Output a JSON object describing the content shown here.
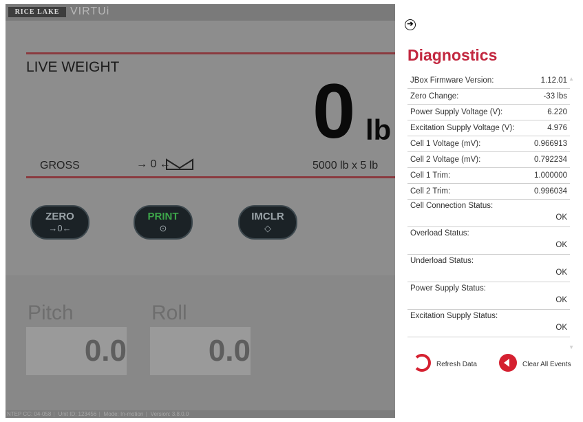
{
  "app": {
    "logo_text": "RICE LAKE",
    "brand": "VIRTUi",
    "live_weight_label": "LIVE WEIGHT",
    "weight_value": "0",
    "weight_unit": "lb",
    "gross_label": "GROSS",
    "zero_symbol": "→ 0 ←",
    "capacity": "5000 lb x 5 lb",
    "buttons": [
      {
        "label": "ZERO",
        "symbol": "→0←"
      },
      {
        "label": "PRINT",
        "symbol": "⊙"
      },
      {
        "label": "IMCLR",
        "symbol": "◇"
      }
    ],
    "pitch_label": "Pitch",
    "pitch_value": "0.0",
    "roll_label": "Roll",
    "roll_value": "0.0",
    "status": {
      "ntep": "NTEP CC: 04-058",
      "unit_id": "Unit ID: 123456",
      "mode": "Mode: In-motion",
      "version": "Version: 3.8.0.0"
    },
    "colors": {
      "accent_red": "#c2273f",
      "print_green": "#3da64a"
    }
  },
  "diagnostics": {
    "title": "Diagnostics",
    "rows": [
      {
        "label": "JBox Firmware Version:",
        "value": "1.12.01"
      },
      {
        "label": "Zero Change:",
        "value": "-33 lbs"
      },
      {
        "label": "Power Supply Voltage (V):",
        "value": "6.220"
      },
      {
        "label": "Excitation Supply Voltage (V):",
        "value": "4.976"
      },
      {
        "label": "Cell 1 Voltage (mV):",
        "value": "0.966913"
      },
      {
        "label": "Cell 2 Voltage (mV):",
        "value": "0.792234"
      },
      {
        "label": "Cell 1 Trim:",
        "value": "1.000000"
      },
      {
        "label": "Cell 2 Trim:",
        "value": "0.996034"
      },
      {
        "label": "Cell Connection Status:",
        "value": "OK"
      },
      {
        "label": "Overload Status:",
        "value": "OK"
      },
      {
        "label": "Underload Status:",
        "value": "OK"
      },
      {
        "label": "Power Supply Status:",
        "value": "OK"
      },
      {
        "label": "Excitation Supply Status:",
        "value": "OK"
      }
    ],
    "refresh_label": "Refresh Data",
    "clear_label": "Clear All Events"
  }
}
